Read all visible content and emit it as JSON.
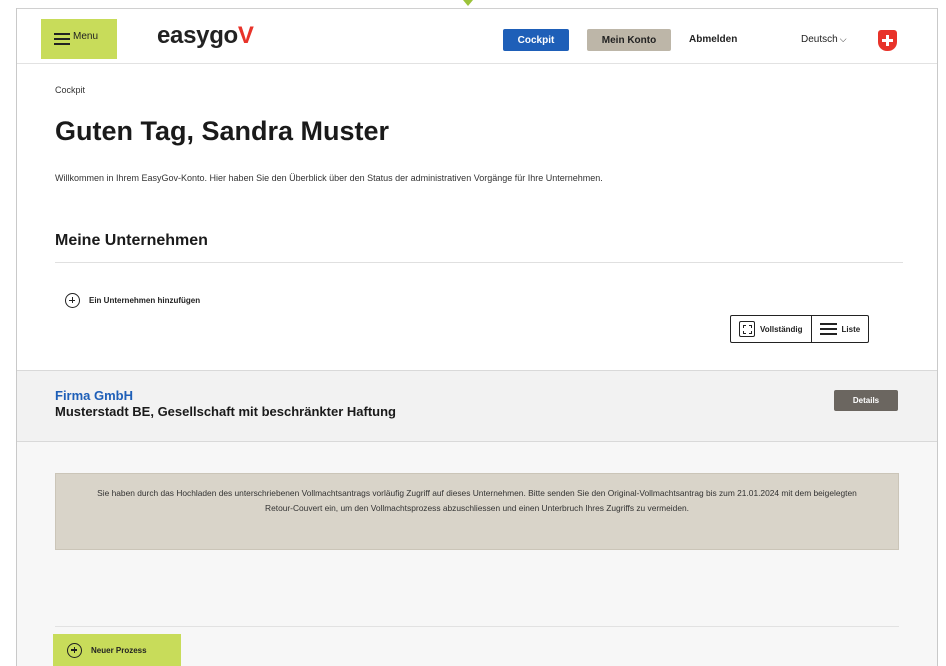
{
  "header": {
    "menu_label": "Menu",
    "logo_text": "easygo",
    "logo_accent": "V",
    "nav": {
      "cockpit": "Cockpit",
      "konto": "Mein Konto",
      "abmelden": "Abmelden"
    },
    "language": "Deutsch",
    "colors": {
      "menu_bg": "#c8dc5a",
      "cockpit_bg": "#1e5fb8",
      "konto_bg": "#bdb6a8",
      "flag": "#e8332a"
    }
  },
  "breadcrumb": "Cockpit",
  "greeting": "Guten Tag, Sandra Muster",
  "welcome_text": "Willkommen in Ihrem EasyGov-Konto. Hier haben Sie den Überblick über den Status der administrativen Vorgänge für Ihre Unternehmen.",
  "companies_section": {
    "title": "Meine Unternehmen",
    "add_label": "Ein Unternehmen hinzufügen",
    "view_full": "Vollständig",
    "view_list": "Liste"
  },
  "company": {
    "name": "Firma GmbH",
    "subtitle": "Musterstadt BE, Gesellschaft mit beschränkter Haftung",
    "details_label": "Details"
  },
  "notice": "Sie haben durch das Hochladen des unterschriebenen Vollmachtsantrags vorläufig Zugriff auf dieses Unternehmen. Bitte senden Sie den Original-Vollmachtsantrag bis zum 21.01.2024 mit dem beigelegten Retour-Couvert ein, um den Vollmachtsprozess abzuschliessen und einen Unterbruch Ihres Zugriffs zu vermeiden.",
  "new_process_label": "Neuer Prozess",
  "icons": [
    "hamburger-icon",
    "swiss-flag-icon",
    "plus-circle-icon",
    "fullscreen-icon",
    "list-icon",
    "chevron-down-icon"
  ]
}
